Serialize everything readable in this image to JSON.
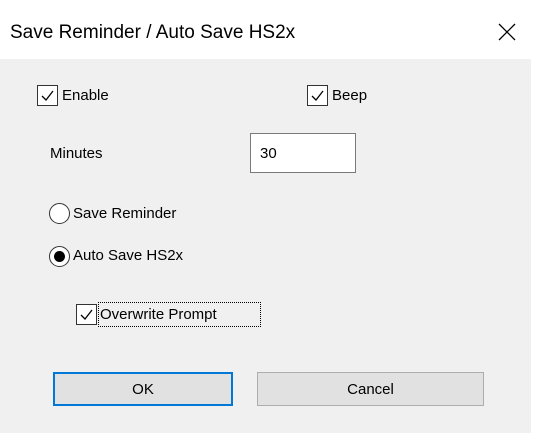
{
  "window": {
    "title": "Save Reminder / Auto Save HS2x",
    "close_icon": "close-icon"
  },
  "options": {
    "enable": {
      "label": "Enable",
      "checked": true
    },
    "beep": {
      "label": "Beep",
      "checked": true
    }
  },
  "minutes": {
    "label": "Minutes",
    "value": "30"
  },
  "mode": {
    "selected": "auto_save",
    "save_reminder": {
      "label": "Save Reminder",
      "selected": false
    },
    "auto_save": {
      "label": "Auto Save HS2x",
      "selected": true
    }
  },
  "overwrite_prompt": {
    "label": "Overwrite Prompt",
    "checked": true
  },
  "buttons": {
    "ok": "OK",
    "cancel": "Cancel"
  },
  "colors": {
    "client_background": "#f0f0f0",
    "button_background": "#e1e1e1",
    "button_border": "#adadad",
    "default_button_border": "#0078d7",
    "textbox_border": "#7a7a7a"
  }
}
